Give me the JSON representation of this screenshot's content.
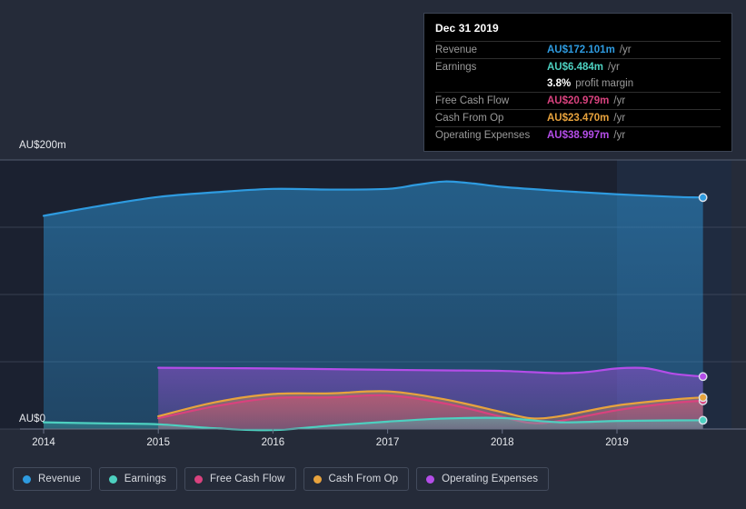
{
  "chart_data": {
    "type": "area",
    "title": "",
    "currency": "AU$",
    "xlabel": "",
    "ylabel": "",
    "ylim": [
      0,
      200
    ],
    "xlim": [
      2014,
      2019.75
    ],
    "grid": true,
    "legend_position": "bottom",
    "y_ticks": [
      "AU$200m",
      "AU$0"
    ],
    "y_tick_values": [
      200,
      0
    ],
    "x_ticks": [
      "2014",
      "2015",
      "2016",
      "2017",
      "2018",
      "2019"
    ],
    "x_tick_values": [
      2014,
      2015,
      2016,
      2017,
      2018,
      2019
    ],
    "highlight_band_start": 2019,
    "series": [
      {
        "name": "Revenue",
        "color": "#2E9BE0",
        "fill": "rgba(45,115,175,0.55)",
        "x": [
          2014.0,
          2014.5,
          2015.0,
          2015.5,
          2016.0,
          2016.5,
          2017.0,
          2017.25,
          2017.5,
          2017.75,
          2018.0,
          2018.5,
          2019.0,
          2019.5,
          2019.75
        ],
        "values": [
          158.5,
          166.0,
          172.5,
          176.0,
          178.5,
          178.0,
          178.5,
          181.5,
          184.0,
          182.5,
          180.0,
          177.0,
          174.5,
          172.6,
          172.101
        ],
        "end_value": 172.101
      },
      {
        "name": "Earnings",
        "color": "#4DD0C0",
        "fill": "rgba(77,208,192,0.18)",
        "x": [
          2014.0,
          2014.5,
          2015.0,
          2015.5,
          2016.0,
          2016.5,
          2017.0,
          2017.5,
          2018.0,
          2018.5,
          2019.0,
          2019.5,
          2019.75
        ],
        "values": [
          5.0,
          4.2,
          3.5,
          0.5,
          -0.8,
          2.5,
          5.5,
          7.8,
          8.2,
          5.0,
          6.0,
          6.4,
          6.484
        ],
        "end_value": 6.484
      },
      {
        "name": "Free Cash Flow",
        "color": "#D9427E",
        "fill": "rgba(217,66,126,0.30)",
        "x": [
          2015.0,
          2015.5,
          2016.0,
          2016.5,
          2017.0,
          2017.5,
          2018.0,
          2018.25,
          2018.5,
          2019.0,
          2019.5,
          2019.75
        ],
        "values": [
          8.0,
          17.0,
          23.0,
          23.5,
          25.0,
          19.0,
          9.0,
          4.5,
          6.0,
          14.0,
          19.5,
          20.979
        ],
        "end_value": 20.979
      },
      {
        "name": "Cash From Op",
        "color": "#E8A33D",
        "fill": "rgba(232,163,61,0.22)",
        "x": [
          2015.0,
          2015.5,
          2016.0,
          2016.5,
          2017.0,
          2017.5,
          2018.0,
          2018.25,
          2018.5,
          2019.0,
          2019.5,
          2019.75
        ],
        "values": [
          9.5,
          20.0,
          26.0,
          26.5,
          28.0,
          22.0,
          12.5,
          8.0,
          9.5,
          17.5,
          22.0,
          23.47
        ],
        "end_value": 23.47
      },
      {
        "name": "Operating Expenses",
        "color": "#B44DE8",
        "fill": "rgba(140,80,200,0.34)",
        "x": [
          2015.0,
          2015.5,
          2016.0,
          2016.5,
          2017.0,
          2017.5,
          2018.0,
          2018.5,
          2018.75,
          2019.0,
          2019.25,
          2019.5,
          2019.75
        ],
        "values": [
          45.5,
          45.3,
          45.0,
          44.5,
          44.0,
          43.6,
          43.2,
          41.5,
          42.5,
          45.0,
          45.2,
          41.0,
          38.997
        ],
        "end_value": 38.997
      }
    ]
  },
  "tooltip": {
    "title": "Dec 31 2019",
    "rows": [
      {
        "name": "Revenue",
        "value": "AU$172.101m",
        "unit": "/yr",
        "color": "#2E9BE0"
      },
      {
        "name": "Earnings",
        "value": "AU$6.484m",
        "unit": "/yr",
        "color": "#4DD0C0"
      },
      {
        "name": "",
        "value": "3.8%",
        "unit": "profit margin",
        "color": "#FFFFFF"
      },
      {
        "name": "Free Cash Flow",
        "value": "AU$20.979m",
        "unit": "/yr",
        "color": "#D9427E"
      },
      {
        "name": "Cash From Op",
        "value": "AU$23.470m",
        "unit": "/yr",
        "color": "#E8A33D"
      },
      {
        "name": "Operating Expenses",
        "value": "AU$38.997m",
        "unit": "/yr",
        "color": "#B44DE8"
      }
    ]
  },
  "legend": {
    "items": [
      {
        "label": "Revenue",
        "color": "#2E9BE0"
      },
      {
        "label": "Earnings",
        "color": "#4DD0C0"
      },
      {
        "label": "Free Cash Flow",
        "color": "#D9427E"
      },
      {
        "label": "Cash From Op",
        "color": "#E8A33D"
      },
      {
        "label": "Operating Expenses",
        "color": "#B44DE8"
      }
    ]
  }
}
